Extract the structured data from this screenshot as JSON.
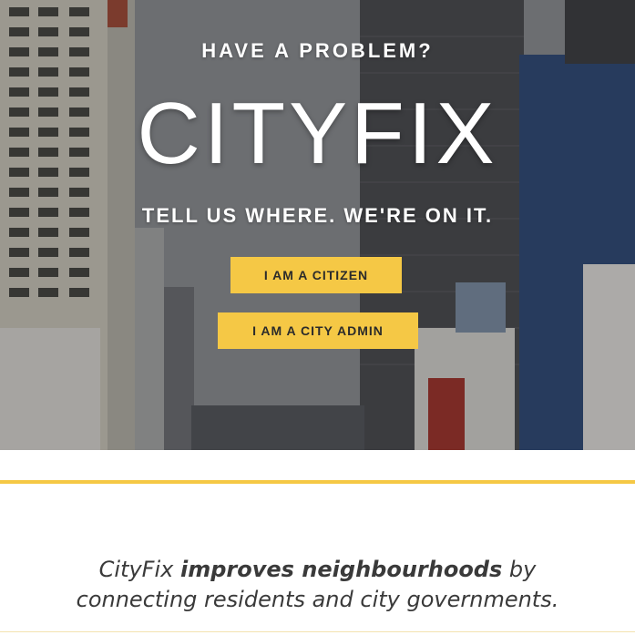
{
  "hero": {
    "kicker": "HAVE A PROBLEM?",
    "brand": "CITYFIX",
    "tagline": "TELL US WHERE. WE'RE ON IT.",
    "buttons": {
      "citizen": "I AM A CITIZEN",
      "admin": "I AM A CITY ADMIN"
    }
  },
  "about": {
    "brand_word": "CityFix",
    "emphasis": "improves neighbourhoods",
    "rest_line1": " by",
    "line2": "connecting residents and city governments."
  },
  "colors": {
    "accent": "#f5c845",
    "text_dark": "#3a3a3a"
  }
}
